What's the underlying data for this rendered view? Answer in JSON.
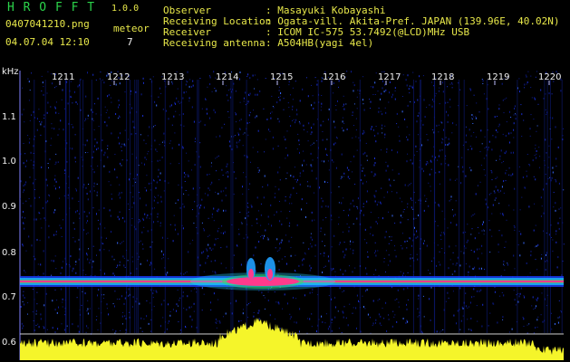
{
  "app": {
    "name": "H R O F F T",
    "version": "1.0.0",
    "filename": "0407041210.png",
    "datetime": "04.07.04 12:10",
    "meteor_label": "meteor",
    "meteor_count": "7"
  },
  "info": [
    {
      "label": "Observer",
      "value": ": Masayuki Kobayashi"
    },
    {
      "label": "Receiving Location",
      "value": ": Ogata-vill. Akita-Pref. JAPAN (139.96E, 40.02N)"
    },
    {
      "label": "Receiver",
      "value": ": ICOM IC-575 53.7492(@LCD)MHz USB"
    },
    {
      "label": "Receiving antenna",
      "value": ": A504HB(yagi 4el)"
    }
  ],
  "axis": {
    "y_unit": "kHz",
    "y_ticks": [
      "1.1",
      "1.0",
      "0.9",
      "0.8",
      "0.7",
      "0.6"
    ],
    "x_ticks": [
      "1211",
      "1212",
      "1213",
      "1214",
      "1215",
      "1216",
      "1217",
      "1218",
      "1219",
      "1220"
    ]
  },
  "colors": {
    "background": "#000000",
    "title": "#2bd34a",
    "label": "#e8e84a",
    "signal_core": "#ff3a8c",
    "signal_edge": "#20d0ff",
    "noise": "#1a3cff",
    "profile": "#f5f52a"
  }
}
